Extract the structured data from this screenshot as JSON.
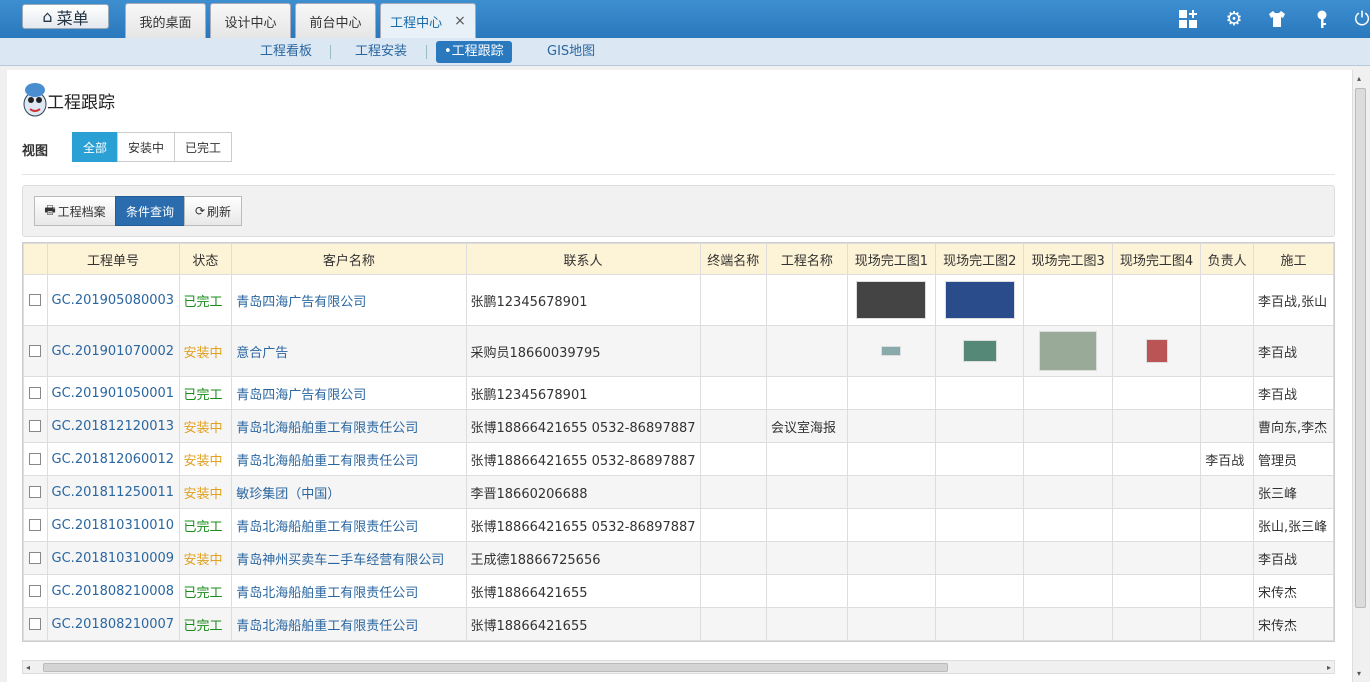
{
  "topbar": {
    "menu_label": "菜单",
    "tabs": [
      {
        "label": "我的桌面"
      },
      {
        "label": "设计中心"
      },
      {
        "label": "前台中心"
      },
      {
        "label": "工程中心",
        "close": "×"
      }
    ],
    "icons": [
      "grid-plus-icon",
      "gear-icon",
      "shirt-icon",
      "key-icon",
      "power-icon"
    ]
  },
  "subnav": {
    "items": [
      {
        "label": "工程看板"
      },
      {
        "label": "工程安装"
      },
      {
        "label": "•工程跟踪"
      },
      {
        "label": "GIS地图"
      }
    ]
  },
  "page": {
    "title": "工程跟踪",
    "view_label": "视图",
    "view_options": [
      "全部",
      "安装中",
      "已完工"
    ],
    "toolbar": {
      "archive": "工程档案",
      "query": "条件查询",
      "refresh": "刷新"
    }
  },
  "table": {
    "headers": [
      "工程单号",
      "状态",
      "客户名称",
      "联系人",
      "终端名称",
      "工程名称",
      "现场完工图1",
      "现场完工图2",
      "现场完工图3",
      "现场完工图4",
      "负责人",
      "施工"
    ],
    "rows": [
      {
        "no": "GC.201905080003",
        "status": "已完工",
        "customer": "青岛四海广告有限公司",
        "contact": "张鹏12345678901",
        "terminal": "",
        "project": "",
        "owner": "",
        "crew": "李百战,张山"
      },
      {
        "no": "GC.201901070002",
        "status": "安装中",
        "customer": "意合广告",
        "contact": "采购员18660039795",
        "terminal": "",
        "project": "",
        "owner": "",
        "crew": "李百战"
      },
      {
        "no": "GC.201901050001",
        "status": "已完工",
        "customer": "青岛四海广告有限公司",
        "contact": "张鹏12345678901",
        "terminal": "",
        "project": "",
        "owner": "",
        "crew": "李百战"
      },
      {
        "no": "GC.201812120013",
        "status": "安装中",
        "customer": "青岛北海船舶重工有限责任公司",
        "contact": "张博18866421655 0532-86897887",
        "terminal": "",
        "project": "会议室海报",
        "owner": "",
        "crew": "曹向东,李杰"
      },
      {
        "no": "GC.201812060012",
        "status": "安装中",
        "customer": "青岛北海船舶重工有限责任公司",
        "contact": "张博18866421655 0532-86897887",
        "terminal": "",
        "project": "",
        "owner": "李百战",
        "crew": "管理员"
      },
      {
        "no": "GC.201811250011",
        "status": "安装中",
        "customer": "敏珍集团（中国）",
        "contact": "李晋18660206688",
        "terminal": "",
        "project": "",
        "owner": "",
        "crew": "张三峰"
      },
      {
        "no": "GC.201810310010",
        "status": "已完工",
        "customer": "青岛北海船舶重工有限责任公司",
        "contact": "张博18866421655 0532-86897887",
        "terminal": "",
        "project": "",
        "owner": "",
        "crew": "张山,张三峰"
      },
      {
        "no": "GC.201810310009",
        "status": "安装中",
        "customer": "青岛神州买卖车二手车经营有限公司",
        "contact": "王成德18866725656",
        "terminal": "",
        "project": "",
        "owner": "",
        "crew": "李百战"
      },
      {
        "no": "GC.201808210008",
        "status": "已完工",
        "customer": "青岛北海船舶重工有限责任公司",
        "contact": "张博18866421655",
        "terminal": "",
        "project": "",
        "owner": "",
        "crew": "宋传杰"
      },
      {
        "no": "GC.201808210007",
        "status": "已完工",
        "customer": "青岛北海船舶重工有限责任公司",
        "contact": "张博18866421655",
        "terminal": "",
        "project": "",
        "owner": "",
        "crew": "宋传杰"
      }
    ]
  },
  "colors": {
    "accent": "#2a78bd",
    "done": "#1a8c1a",
    "installing": "#e0a020",
    "header_bg": "#fdf3d6"
  }
}
